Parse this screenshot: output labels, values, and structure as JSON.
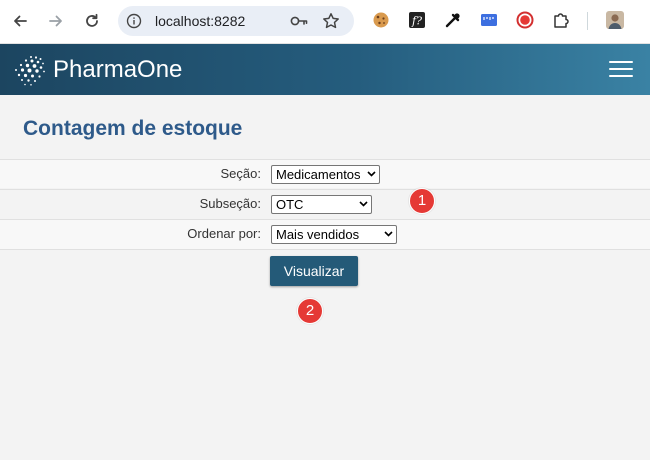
{
  "browser": {
    "url": "localhost:8282",
    "icons": [
      "back-icon",
      "forward-icon",
      "reload-icon",
      "site-info-icon",
      "password-key-icon",
      "bookmark-star-icon"
    ],
    "extensions": [
      "cookie-extension-icon",
      "font-extension-icon",
      "eyedropper-extension-icon",
      "ruler-extension-icon",
      "record-extension-icon",
      "puzzle-extensions-icon",
      "profile-avatar"
    ]
  },
  "app": {
    "brand": "PharmaOne",
    "menu_icon": "hamburger-menu-icon"
  },
  "page": {
    "title": "Contagem de estoque"
  },
  "form": {
    "secao": {
      "label": "Seção:",
      "value": "Medicamentos"
    },
    "subsecao": {
      "label": "Subseção:",
      "value": "OTC"
    },
    "ordenar": {
      "label": "Ordenar por:",
      "value": "Mais vendidos"
    },
    "submit_label": "Visualizar"
  },
  "callouts": [
    "1",
    "2"
  ],
  "colors": {
    "header_start": "#1c4560",
    "header_end": "#3a82a4",
    "title": "#2e5a8a",
    "button": "#245a78",
    "callout": "#e53935"
  }
}
